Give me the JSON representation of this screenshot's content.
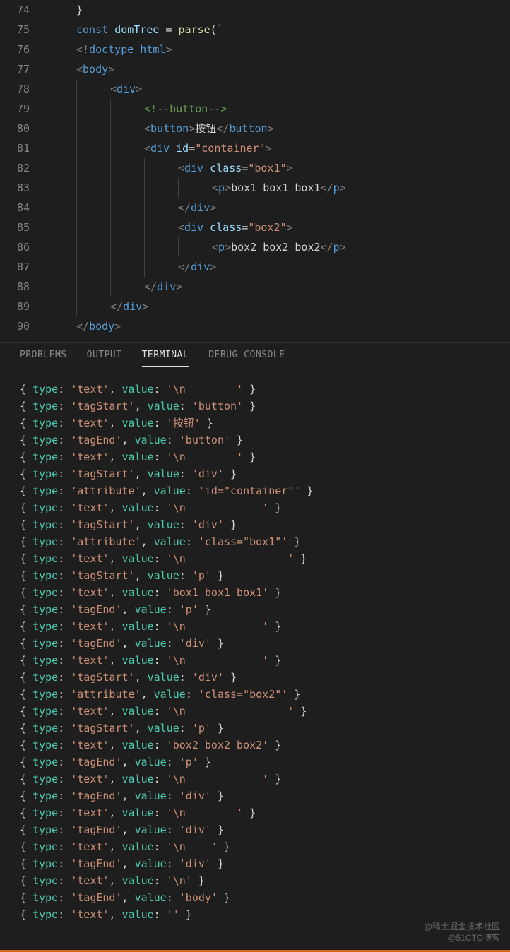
{
  "editor": {
    "lines": [
      {
        "num": "74",
        "indent": 1,
        "guides": [],
        "tokens": [
          {
            "t": "pun",
            "v": "}"
          }
        ]
      },
      {
        "num": "75",
        "indent": 1,
        "guides": [],
        "tokens": [
          {
            "t": "kw",
            "v": "const"
          },
          {
            "t": "pun",
            "v": " "
          },
          {
            "t": "var",
            "v": "domTree"
          },
          {
            "t": "pun",
            "v": " = "
          },
          {
            "t": "fn",
            "v": "parse"
          },
          {
            "t": "pun",
            "v": "("
          },
          {
            "t": "str",
            "v": "`"
          }
        ]
      },
      {
        "num": "76",
        "indent": 1,
        "guides": [],
        "tokens": [
          {
            "t": "tag",
            "v": "<!"
          },
          {
            "t": "tagn",
            "v": "doctype html"
          },
          {
            "t": "tag",
            "v": ">"
          }
        ]
      },
      {
        "num": "77",
        "indent": 1,
        "guides": [],
        "tokens": [
          {
            "t": "tag",
            "v": "<"
          },
          {
            "t": "tagn",
            "v": "body"
          },
          {
            "t": "tag",
            "v": ">"
          }
        ]
      },
      {
        "num": "78",
        "indent": 2,
        "guides": [
          1
        ],
        "tokens": [
          {
            "t": "tag",
            "v": "<"
          },
          {
            "t": "tagn",
            "v": "div"
          },
          {
            "t": "tag",
            "v": ">"
          }
        ]
      },
      {
        "num": "79",
        "indent": 3,
        "guides": [
          1,
          2
        ],
        "tokens": [
          {
            "t": "cmt",
            "v": "<!--button-->"
          }
        ]
      },
      {
        "num": "80",
        "indent": 3,
        "guides": [
          1,
          2
        ],
        "tokens": [
          {
            "t": "tag",
            "v": "<"
          },
          {
            "t": "tagn",
            "v": "button"
          },
          {
            "t": "tag",
            "v": ">"
          },
          {
            "t": "pun",
            "v": "按钮"
          },
          {
            "t": "tag",
            "v": "</"
          },
          {
            "t": "tagn",
            "v": "button"
          },
          {
            "t": "tag",
            "v": ">"
          }
        ]
      },
      {
        "num": "81",
        "indent": 3,
        "guides": [
          1,
          2
        ],
        "tokens": [
          {
            "t": "tag",
            "v": "<"
          },
          {
            "t": "tagn",
            "v": "div"
          },
          {
            "t": "pun",
            "v": " "
          },
          {
            "t": "attr",
            "v": "id"
          },
          {
            "t": "pun",
            "v": "="
          },
          {
            "t": "str",
            "v": "\"container\""
          },
          {
            "t": "tag",
            "v": ">"
          }
        ]
      },
      {
        "num": "82",
        "indent": 4,
        "guides": [
          1,
          2,
          3
        ],
        "tokens": [
          {
            "t": "tag",
            "v": "<"
          },
          {
            "t": "tagn",
            "v": "div"
          },
          {
            "t": "pun",
            "v": " "
          },
          {
            "t": "attr",
            "v": "class"
          },
          {
            "t": "pun",
            "v": "="
          },
          {
            "t": "str",
            "v": "\"box1\""
          },
          {
            "t": "tag",
            "v": ">"
          }
        ]
      },
      {
        "num": "83",
        "indent": 5,
        "guides": [
          1,
          2,
          3,
          4
        ],
        "tokens": [
          {
            "t": "tag",
            "v": "<"
          },
          {
            "t": "tagn",
            "v": "p"
          },
          {
            "t": "tag",
            "v": ">"
          },
          {
            "t": "pun",
            "v": "box1 box1 box1"
          },
          {
            "t": "tag",
            "v": "</"
          },
          {
            "t": "tagn",
            "v": "p"
          },
          {
            "t": "tag",
            "v": ">"
          }
        ]
      },
      {
        "num": "84",
        "indent": 4,
        "guides": [
          1,
          2,
          3
        ],
        "tokens": [
          {
            "t": "tag",
            "v": "</"
          },
          {
            "t": "tagn",
            "v": "div"
          },
          {
            "t": "tag",
            "v": ">"
          }
        ]
      },
      {
        "num": "85",
        "indent": 4,
        "guides": [
          1,
          2,
          3
        ],
        "tokens": [
          {
            "t": "tag",
            "v": "<"
          },
          {
            "t": "tagn",
            "v": "div"
          },
          {
            "t": "pun",
            "v": " "
          },
          {
            "t": "attr",
            "v": "class"
          },
          {
            "t": "pun",
            "v": "="
          },
          {
            "t": "str",
            "v": "\"box2\""
          },
          {
            "t": "tag",
            "v": ">"
          }
        ]
      },
      {
        "num": "86",
        "indent": 5,
        "guides": [
          1,
          2,
          3,
          4
        ],
        "tokens": [
          {
            "t": "tag",
            "v": "<"
          },
          {
            "t": "tagn",
            "v": "p"
          },
          {
            "t": "tag",
            "v": ">"
          },
          {
            "t": "pun",
            "v": "box2 box2 box2"
          },
          {
            "t": "tag",
            "v": "</"
          },
          {
            "t": "tagn",
            "v": "p"
          },
          {
            "t": "tag",
            "v": ">"
          }
        ]
      },
      {
        "num": "87",
        "indent": 4,
        "guides": [
          1,
          2,
          3
        ],
        "tokens": [
          {
            "t": "tag",
            "v": "</"
          },
          {
            "t": "tagn",
            "v": "div"
          },
          {
            "t": "tag",
            "v": ">"
          }
        ]
      },
      {
        "num": "88",
        "indent": 3,
        "guides": [
          1,
          2
        ],
        "tokens": [
          {
            "t": "tag",
            "v": "</"
          },
          {
            "t": "tagn",
            "v": "div"
          },
          {
            "t": "tag",
            "v": ">"
          }
        ]
      },
      {
        "num": "89",
        "indent": 2,
        "guides": [
          1
        ],
        "tokens": [
          {
            "t": "tag",
            "v": "</"
          },
          {
            "t": "tagn",
            "v": "div"
          },
          {
            "t": "tag",
            "v": ">"
          }
        ]
      },
      {
        "num": "90",
        "indent": 1,
        "guides": [],
        "tokens": [
          {
            "t": "tag",
            "v": "</"
          },
          {
            "t": "tagn",
            "v": "body"
          },
          {
            "t": "tag",
            "v": ">"
          }
        ]
      }
    ]
  },
  "panel": {
    "tabs": [
      {
        "label": "PROBLEMS",
        "active": false
      },
      {
        "label": "OUTPUT",
        "active": false
      },
      {
        "label": "TERMINAL",
        "active": true
      },
      {
        "label": "DEBUG CONSOLE",
        "active": false
      }
    ]
  },
  "terminal": {
    "entries": [
      {
        "type": "text",
        "value": "'\\n        '"
      },
      {
        "type": "tagStart",
        "value": "'button'"
      },
      {
        "type": "text",
        "value": "'按钮'"
      },
      {
        "type": "tagEnd",
        "value": "'button'"
      },
      {
        "type": "text",
        "value": "'\\n        '"
      },
      {
        "type": "tagStart",
        "value": "'div'"
      },
      {
        "type": "attribute",
        "value": "'id=\"container\"'"
      },
      {
        "type": "text",
        "value": "'\\n            '"
      },
      {
        "type": "tagStart",
        "value": "'div'"
      },
      {
        "type": "attribute",
        "value": "'class=\"box1\"'"
      },
      {
        "type": "text",
        "value": "'\\n                '"
      },
      {
        "type": "tagStart",
        "value": "'p'"
      },
      {
        "type": "text",
        "value": "'box1 box1 box1'"
      },
      {
        "type": "tagEnd",
        "value": "'p'"
      },
      {
        "type": "text",
        "value": "'\\n            '"
      },
      {
        "type": "tagEnd",
        "value": "'div'"
      },
      {
        "type": "text",
        "value": "'\\n            '"
      },
      {
        "type": "tagStart",
        "value": "'div'"
      },
      {
        "type": "attribute",
        "value": "'class=\"box2\"'"
      },
      {
        "type": "text",
        "value": "'\\n                '"
      },
      {
        "type": "tagStart",
        "value": "'p'"
      },
      {
        "type": "text",
        "value": "'box2 box2 box2'"
      },
      {
        "type": "tagEnd",
        "value": "'p'"
      },
      {
        "type": "text",
        "value": "'\\n            '"
      },
      {
        "type": "tagEnd",
        "value": "'div'"
      },
      {
        "type": "text",
        "value": "'\\n        '"
      },
      {
        "type": "tagEnd",
        "value": "'div'"
      },
      {
        "type": "text",
        "value": "'\\n    '"
      },
      {
        "type": "tagEnd",
        "value": "'div'"
      },
      {
        "type": "text",
        "value": "'\\n'"
      },
      {
        "type": "tagEnd",
        "value": "'body'"
      },
      {
        "type": "text",
        "value": "''"
      }
    ]
  },
  "watermark": {
    "line1": "@稀土掘金技术社区",
    "line2": "@51CTO博客"
  }
}
